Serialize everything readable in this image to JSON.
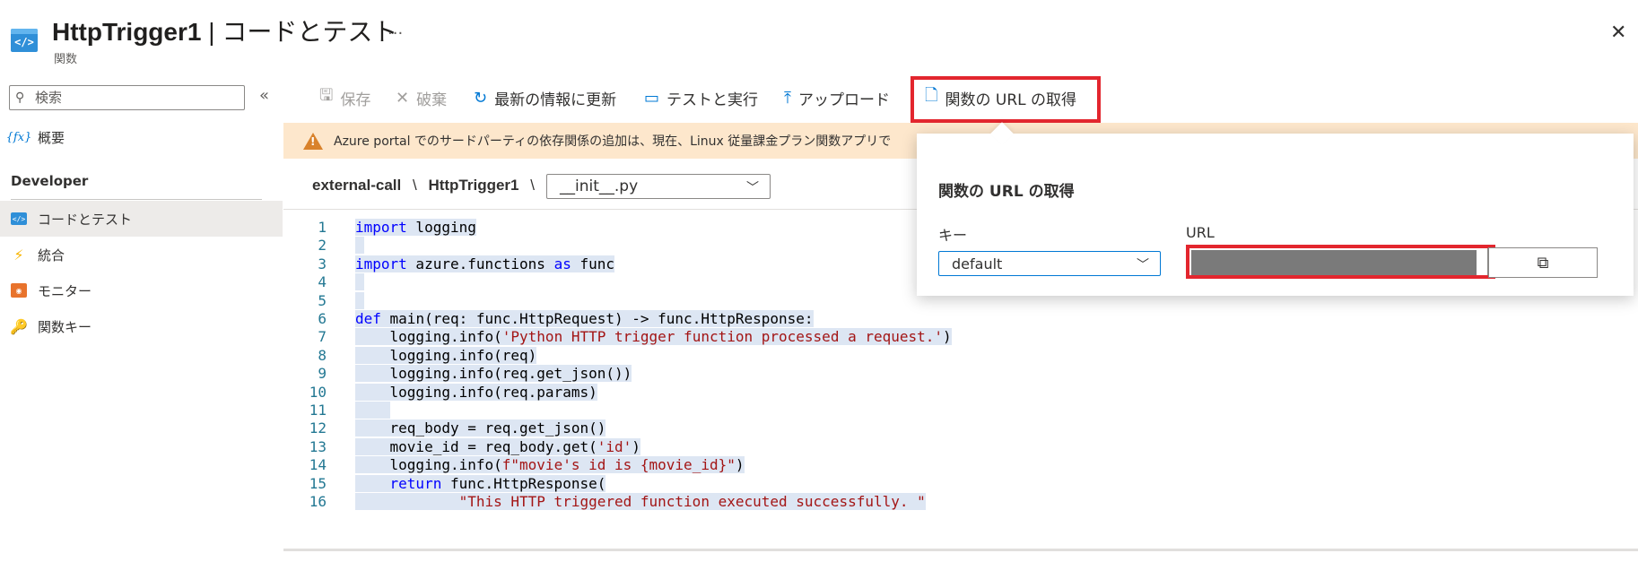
{
  "header": {
    "title": "HttpTrigger1",
    "separator": "|",
    "subtitle": "コードとテスト",
    "more": "...",
    "resource_kind": "関数",
    "icon": "function-app-icon",
    "close": "✕"
  },
  "sidebar": {
    "search_placeholder": "検索",
    "collapse": "«",
    "overview_label": "概要",
    "section_label": "Developer",
    "items": [
      {
        "label": "コードとテスト",
        "icon": "code-icon",
        "active": true
      },
      {
        "label": "統合",
        "icon": "lightning-icon",
        "active": false
      },
      {
        "label": "モニター",
        "icon": "monitor-icon",
        "active": false
      },
      {
        "label": "関数キー",
        "icon": "key-icon",
        "active": false
      }
    ]
  },
  "toolbar": {
    "save": "保存",
    "discard": "破棄",
    "refresh": "最新の情報に更新",
    "test_run": "テストと実行",
    "upload": "アップロード",
    "get_url": "関数の URL の取得"
  },
  "warning": {
    "text": "Azure portal でのサードパーティの依存関係の追加は、現在、Linux 従量課金プラン関数アプリで"
  },
  "breadcrumb": {
    "app": "external-call",
    "separator": "\\",
    "function": "HttpTrigger1",
    "file": "__init__.py"
  },
  "code_lines": [
    {
      "n": "1",
      "text": "import logging"
    },
    {
      "n": "2",
      "text": ""
    },
    {
      "n": "3",
      "text": "import azure.functions as func"
    },
    {
      "n": "4",
      "text": ""
    },
    {
      "n": "5",
      "text": ""
    },
    {
      "n": "6",
      "text": "def main(req: func.HttpRequest) -> func.HttpResponse:"
    },
    {
      "n": "7",
      "text": "    logging.info('Python HTTP trigger function processed a request.')"
    },
    {
      "n": "8",
      "text": "    logging.info(req)"
    },
    {
      "n": "9",
      "text": "    logging.info(req.get_json())"
    },
    {
      "n": "10",
      "text": "    logging.info(req.params)"
    },
    {
      "n": "11",
      "text": "    "
    },
    {
      "n": "12",
      "text": "    req_body = req.get_json()"
    },
    {
      "n": "13",
      "text": "    movie_id = req_body.get('id')"
    },
    {
      "n": "14",
      "text": "    logging.info(f\"movie's id is {movie_id}\")"
    },
    {
      "n": "15",
      "text": "    return func.HttpResponse("
    },
    {
      "n": "16",
      "text": "            \"This HTTP triggered function executed successfully. \""
    }
  ],
  "popup": {
    "title": "関数の URL の取得",
    "key_label": "キー",
    "key_value": "default",
    "url_label": "URL",
    "copy_icon": "copy-icon"
  },
  "colors": {
    "accent": "#0078d4",
    "highlight": "#e3262e",
    "warning_bg": "#fde7cc"
  }
}
